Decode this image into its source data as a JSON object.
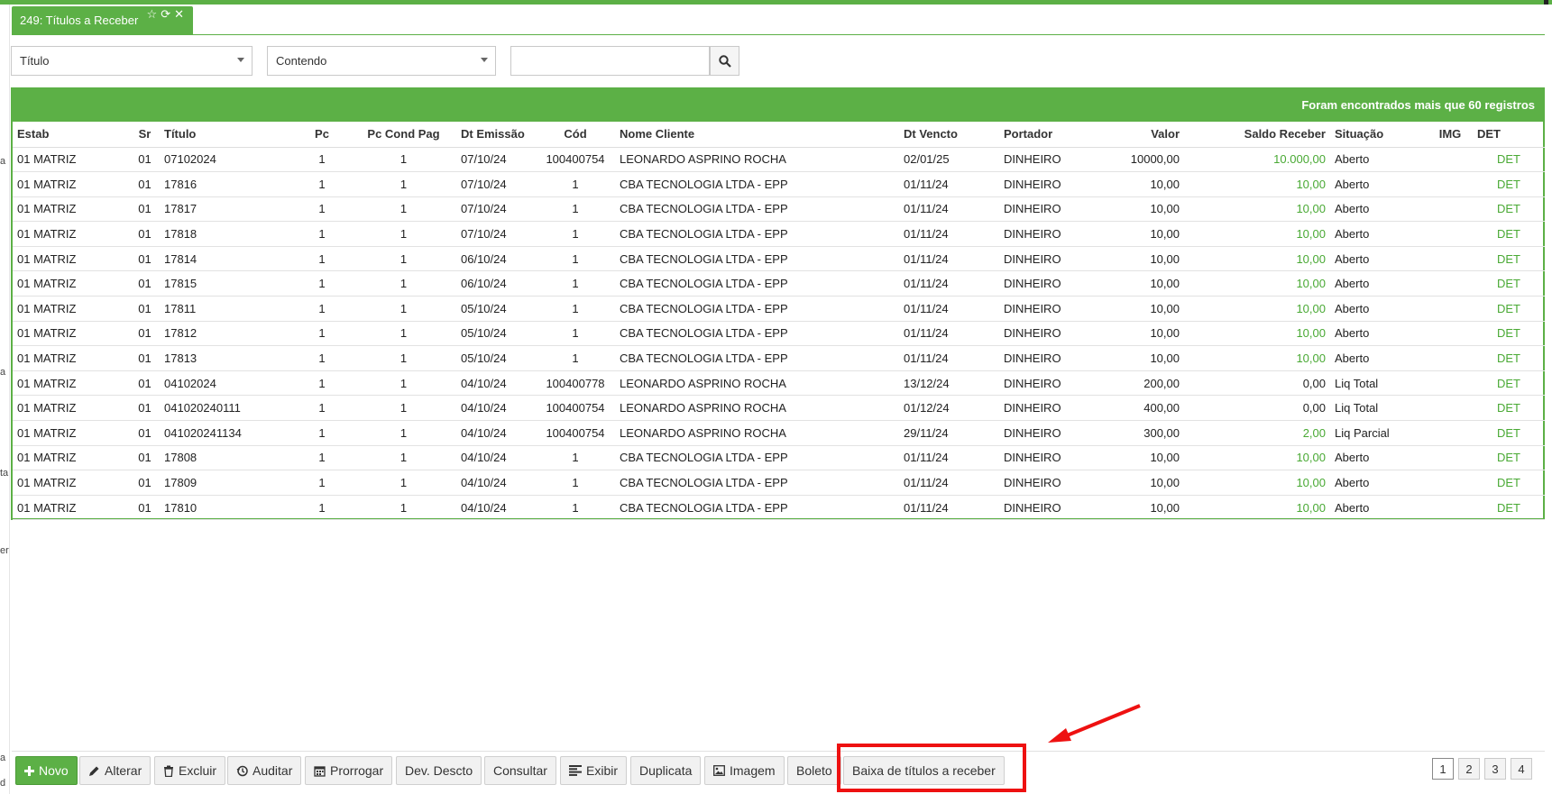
{
  "tab": {
    "title": "249: Títulos a Receber"
  },
  "filters": {
    "field": "Título",
    "operator": "Contendo",
    "search_value": ""
  },
  "grid": {
    "banner": "Foram encontrados mais que 60 registros",
    "columns": [
      "Estab",
      "Sr",
      "Título",
      "Pc",
      "Pc Cond Pag",
      "Dt Emissão",
      "Cód",
      "Nome Cliente",
      "Dt Vencto",
      "Portador",
      "Valor",
      "Saldo Receber",
      "Situação",
      "IMG",
      "DET"
    ],
    "rows": [
      [
        "01 MATRIZ",
        "01",
        "07102024",
        "1",
        "1",
        "07/10/24",
        "100400754",
        "LEONARDO ASPRINO ROCHA",
        "02/01/25",
        "DINHEIRO",
        "10000,00",
        "10.000,00",
        "Aberto",
        "",
        "DET"
      ],
      [
        "01 MATRIZ",
        "01",
        "17816",
        "1",
        "1",
        "07/10/24",
        "1",
        "CBA TECNOLOGIA LTDA - EPP",
        "01/11/24",
        "DINHEIRO",
        "10,00",
        "10,00",
        "Aberto",
        "",
        "DET"
      ],
      [
        "01 MATRIZ",
        "01",
        "17817",
        "1",
        "1",
        "07/10/24",
        "1",
        "CBA TECNOLOGIA LTDA - EPP",
        "01/11/24",
        "DINHEIRO",
        "10,00",
        "10,00",
        "Aberto",
        "",
        "DET"
      ],
      [
        "01 MATRIZ",
        "01",
        "17818",
        "1",
        "1",
        "07/10/24",
        "1",
        "CBA TECNOLOGIA LTDA - EPP",
        "01/11/24",
        "DINHEIRO",
        "10,00",
        "10,00",
        "Aberto",
        "",
        "DET"
      ],
      [
        "01 MATRIZ",
        "01",
        "17814",
        "1",
        "1",
        "06/10/24",
        "1",
        "CBA TECNOLOGIA LTDA - EPP",
        "01/11/24",
        "DINHEIRO",
        "10,00",
        "10,00",
        "Aberto",
        "",
        "DET"
      ],
      [
        "01 MATRIZ",
        "01",
        "17815",
        "1",
        "1",
        "06/10/24",
        "1",
        "CBA TECNOLOGIA LTDA - EPP",
        "01/11/24",
        "DINHEIRO",
        "10,00",
        "10,00",
        "Aberto",
        "",
        "DET"
      ],
      [
        "01 MATRIZ",
        "01",
        "17811",
        "1",
        "1",
        "05/10/24",
        "1",
        "CBA TECNOLOGIA LTDA - EPP",
        "01/11/24",
        "DINHEIRO",
        "10,00",
        "10,00",
        "Aberto",
        "",
        "DET"
      ],
      [
        "01 MATRIZ",
        "01",
        "17812",
        "1",
        "1",
        "05/10/24",
        "1",
        "CBA TECNOLOGIA LTDA - EPP",
        "01/11/24",
        "DINHEIRO",
        "10,00",
        "10,00",
        "Aberto",
        "",
        "DET"
      ],
      [
        "01 MATRIZ",
        "01",
        "17813",
        "1",
        "1",
        "05/10/24",
        "1",
        "CBA TECNOLOGIA LTDA - EPP",
        "01/11/24",
        "DINHEIRO",
        "10,00",
        "10,00",
        "Aberto",
        "",
        "DET"
      ],
      [
        "01 MATRIZ",
        "01",
        "04102024",
        "1",
        "1",
        "04/10/24",
        "100400778",
        "LEONARDO ASPRINO ROCHA",
        "13/12/24",
        "DINHEIRO",
        "200,00",
        "0,00",
        "Liq Total",
        "",
        "DET"
      ],
      [
        "01 MATRIZ",
        "01",
        "041020240111",
        "1",
        "1",
        "04/10/24",
        "100400754",
        "LEONARDO ASPRINO ROCHA",
        "01/12/24",
        "DINHEIRO",
        "400,00",
        "0,00",
        "Liq Total",
        "",
        "DET"
      ],
      [
        "01 MATRIZ",
        "01",
        "041020241134",
        "1",
        "1",
        "04/10/24",
        "100400754",
        "LEONARDO ASPRINO ROCHA",
        "29/11/24",
        "DINHEIRO",
        "300,00",
        "2,00",
        "Liq Parcial",
        "",
        "DET"
      ],
      [
        "01 MATRIZ",
        "01",
        "17808",
        "1",
        "1",
        "04/10/24",
        "1",
        "CBA TECNOLOGIA LTDA - EPP",
        "01/11/24",
        "DINHEIRO",
        "10,00",
        "10,00",
        "Aberto",
        "",
        "DET"
      ],
      [
        "01 MATRIZ",
        "01",
        "17809",
        "1",
        "1",
        "04/10/24",
        "1",
        "CBA TECNOLOGIA LTDA - EPP",
        "01/11/24",
        "DINHEIRO",
        "10,00",
        "10,00",
        "Aberto",
        "",
        "DET"
      ],
      [
        "01 MATRIZ",
        "01",
        "17810",
        "1",
        "1",
        "04/10/24",
        "1",
        "CBA TECNOLOGIA LTDA - EPP",
        "01/11/24",
        "DINHEIRO",
        "10,00",
        "10,00",
        "Aberto",
        "",
        "DET"
      ]
    ]
  },
  "toolbar": {
    "novo": "Novo",
    "alterar": "Alterar",
    "excluir": "Excluir",
    "auditar": "Auditar",
    "prorrogar": "Prorrogar",
    "dev_descto": "Dev. Descto",
    "consultar": "Consultar",
    "exibir": "Exibir",
    "duplicata": "Duplicata",
    "imagem": "Imagem",
    "boleto": "Boleto",
    "baixa": "Baixa de títulos a receber"
  },
  "pagination": {
    "pages": [
      "1",
      "2",
      "3",
      "4"
    ],
    "current": "1"
  },
  "left_strip": {
    "fragments": [
      "a",
      "a",
      "ta",
      "er",
      "a",
      "d"
    ]
  },
  "colors": {
    "accent": "#5cb046",
    "highlight": "#ee1111"
  }
}
